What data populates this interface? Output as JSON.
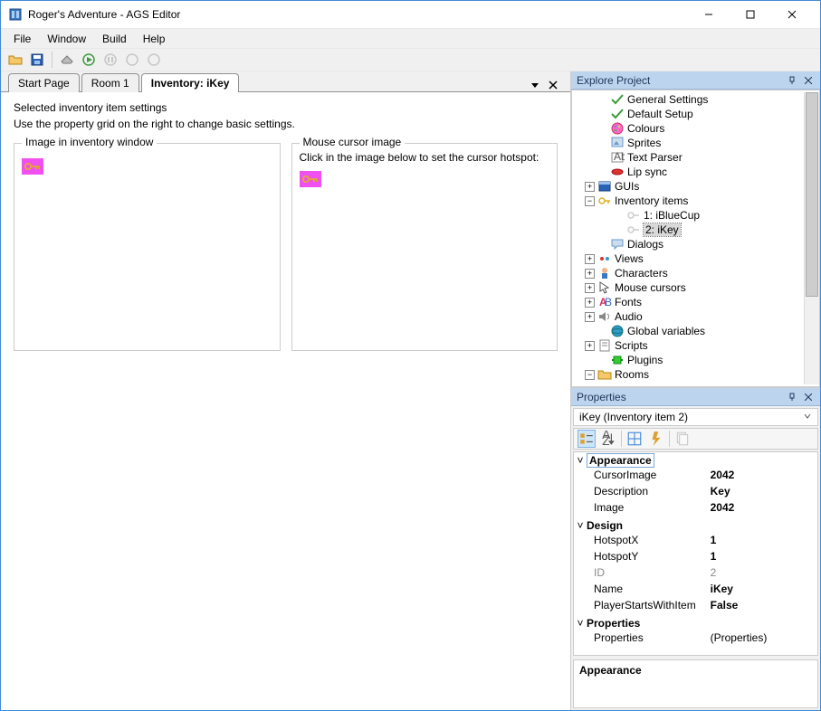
{
  "window": {
    "title": "Roger's Adventure - AGS Editor"
  },
  "menus": {
    "file": "File",
    "window": "Window",
    "build": "Build",
    "help": "Help"
  },
  "tabs": {
    "start": "Start Page",
    "room": "Room 1",
    "inventory": "Inventory: iKey"
  },
  "editor": {
    "heading": "Selected inventory item settings",
    "hint": "Use the property grid on the right to change basic settings.",
    "imageGroup": "Image in inventory window",
    "cursorGroup": "Mouse cursor image",
    "cursorHint": "Click in the image below to set the cursor hotspot:"
  },
  "explore": {
    "title": "Explore Project",
    "items": {
      "general": "General Settings",
      "defaultSetup": "Default Setup",
      "colours": "Colours",
      "sprites": "Sprites",
      "textParser": "Text Parser",
      "lipSync": "Lip sync",
      "guis": "GUIs",
      "inventory": "Inventory items",
      "inv1": "1: iBlueCup",
      "inv2": "2: iKey",
      "dialogs": "Dialogs",
      "views": "Views",
      "characters": "Characters",
      "mouseCursors": "Mouse cursors",
      "fonts": "Fonts",
      "audio": "Audio",
      "globals": "Global variables",
      "scripts": "Scripts",
      "plugins": "Plugins",
      "rooms": "Rooms"
    }
  },
  "properties": {
    "title": "Properties",
    "object": "iKey (Inventory item 2)",
    "catAppearance": "Appearance",
    "catDesign": "Design",
    "catProperties": "Properties",
    "rows": {
      "cursorImage": {
        "n": "CursorImage",
        "v": "2042"
      },
      "description": {
        "n": "Description",
        "v": "Key"
      },
      "image": {
        "n": "Image",
        "v": "2042"
      },
      "hotspotX": {
        "n": "HotspotX",
        "v": "1"
      },
      "hotspotY": {
        "n": "HotspotY",
        "v": "1"
      },
      "id": {
        "n": "ID",
        "v": "2"
      },
      "name": {
        "n": "Name",
        "v": "iKey"
      },
      "playerStarts": {
        "n": "PlayerStartsWithItem",
        "v": "False"
      },
      "properties": {
        "n": "Properties",
        "v": "(Properties)"
      }
    },
    "descTitle": "Appearance"
  }
}
